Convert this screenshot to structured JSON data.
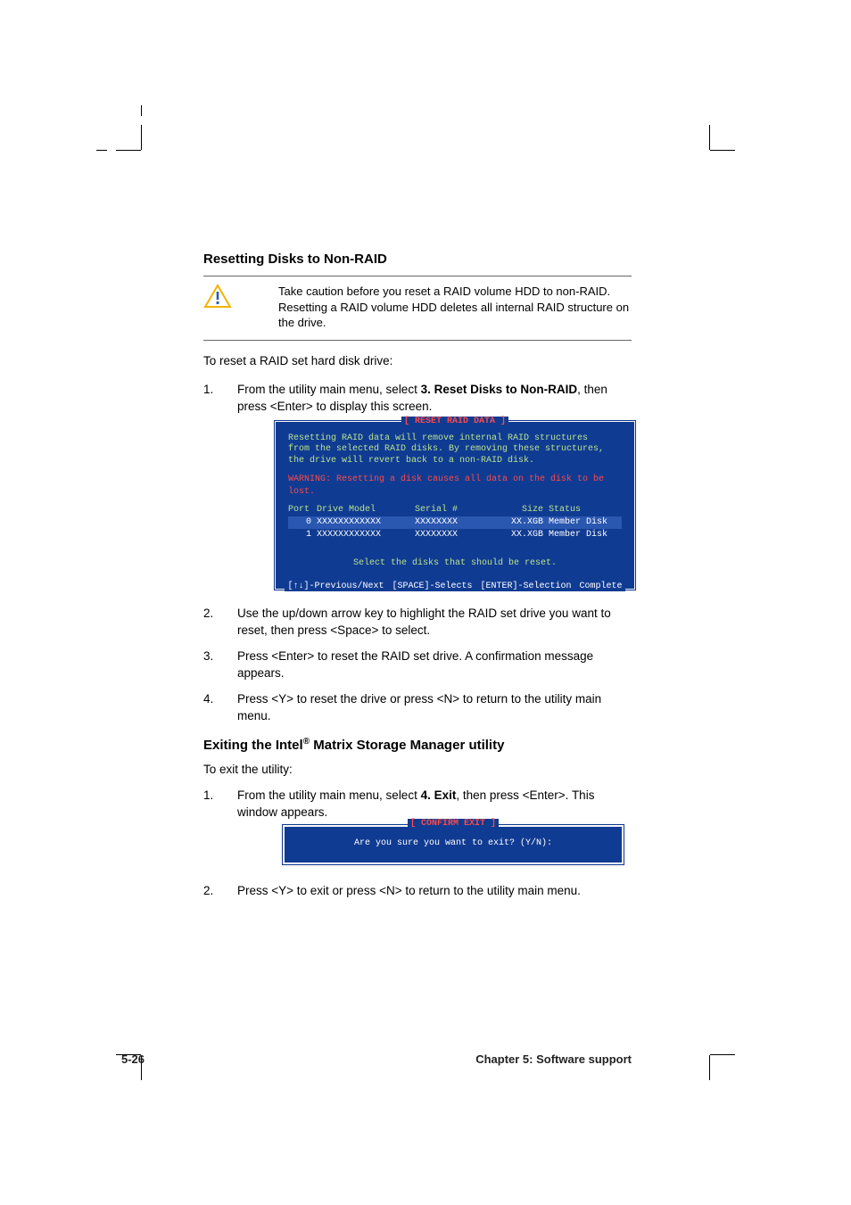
{
  "section1": {
    "heading": "Resetting Disks to Non-RAID",
    "caution": "Take caution before you reset a RAID volume HDD to non-RAID. Resetting a RAID volume HDD deletes all internal RAID structure on the drive.",
    "lead": "To reset a RAID set hard disk drive:",
    "steps": {
      "s1_num": "1.",
      "s1_a": "From the utility main menu, select ",
      "s1_b": "3. Reset Disks to Non-RAID",
      "s1_c": ", then press <Enter> to display this screen.",
      "s2_num": "2.",
      "s2": "Use the up/down arrow key to highlight the RAID set drive you want to reset, then press <Space> to select.",
      "s3_num": "3.",
      "s3": "Press <Enter> to reset the RAID set drive. A confirmation message appears.",
      "s4_num": "4.",
      "s4": "Press <Y> to reset the drive or press <N> to return to the utility main menu."
    }
  },
  "bios1": {
    "title": "[ RESET RAID DATA ]",
    "l1": "Resetting RAID data will remove internal RAID structures",
    "l2": "from the selected RAID disks. By removing these structures,",
    "l3": "the drive will revert back to a non-RAID disk.",
    "warn": "WARNING: Resetting a disk causes all data on the disk to be lost.",
    "hdr": {
      "port": "Port",
      "model": "Drive Model",
      "serial": "Serial #",
      "size": "Size",
      "status": "Status"
    },
    "rows": [
      {
        "port": "0",
        "model": "XXXXXXXXXXXX",
        "serial": "XXXXXXXX",
        "size": "XX.XGB",
        "status": "Member Disk"
      },
      {
        "port": "1",
        "model": "XXXXXXXXXXXX",
        "serial": "XXXXXXXX",
        "size": "XX.XGB",
        "status": "Member Disk"
      }
    ],
    "prompt": "Select the disks that should be reset.",
    "footer": "[↑↓]-Previous/Next  [SPACE]-Selects  [ENTER]-Selection Complete"
  },
  "section2": {
    "heading_a": "Exiting the Intel",
    "heading_reg": "®",
    "heading_b": " Matrix Storage Manager utility",
    "lead": "To exit the utility:",
    "steps": {
      "s1_num": "1.",
      "s1_a": "From the utility main menu, select ",
      "s1_b": "4. Exit",
      "s1_c": ", then press <Enter>. This window appears.",
      "s2_num": "2.",
      "s2": "Press <Y> to exit or press <N> to return to the utility main menu."
    }
  },
  "bios2": {
    "title": "[ CONFIRM EXIT ]",
    "msg": "Are you sure you want to exit? (Y/N):"
  },
  "footer": {
    "page": "5-26",
    "chapter": "Chapter 5: Software support"
  }
}
